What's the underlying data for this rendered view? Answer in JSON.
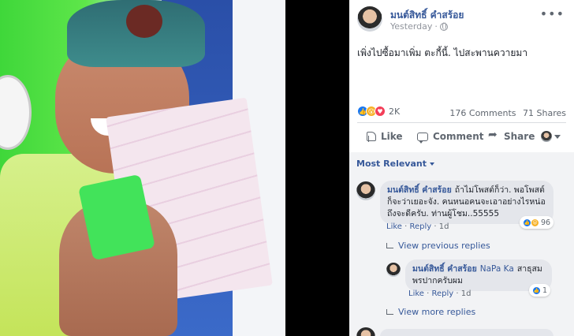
{
  "post": {
    "author": "มนต์สิทธิ์ คำสร้อย",
    "time": "Yesterday",
    "privacy_icon": "globe-icon",
    "more_icon": "more-icon",
    "text": "เพิ่งไปซื้อมาเพิ่ม ตะกี้นี้. ไปสะพานควายมา",
    "reactions": {
      "icons": [
        "like",
        "wow",
        "love"
      ],
      "count": "2K"
    },
    "comments_count": "176 Comments",
    "shares_count": "71 Shares"
  },
  "actions": {
    "like_label": "Like",
    "comment_label": "Comment",
    "share_label": "Share"
  },
  "comments": {
    "sort_label": "Most Relevant",
    "items": [
      {
        "author": "มนต์สิทธิ์ คำสร้อย",
        "text": "ถ้าไม่โพสต์ก็ว่า. พอโพสต์ก็จะว่าเยอะจัง. คนหนอคนจะเอาอย่างไรหน่อถึงจะดีครับ. ท่านผู้โชม..55555",
        "like_label": "Like",
        "reply_label": "Reply",
        "time": "1d",
        "reaction_count": "96"
      }
    ],
    "view_previous": "View previous replies",
    "reply": {
      "author": "มนต์สิทธิ์ คำสร้อย",
      "tagged": "NaPa Ka",
      "text": "สาธุสมพรปากครับผม",
      "like_label": "Like",
      "reply_label": "Reply",
      "time": "1d",
      "reaction_count": "1"
    },
    "view_more": "View more replies"
  },
  "colors": {
    "link_blue": "#365899",
    "like_blue": "#1877f2",
    "love_red": "#f33e58",
    "wow_yellow": "#f7b125",
    "panel_bg": "#ffffff",
    "comments_bg": "#f2f3f5"
  }
}
